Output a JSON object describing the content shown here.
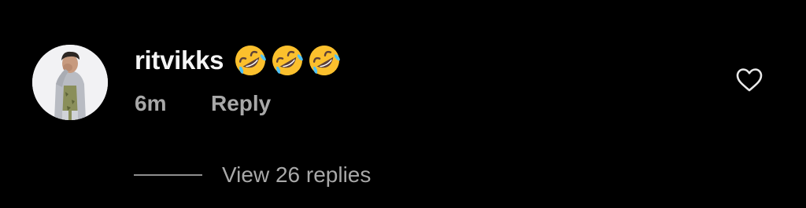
{
  "comment": {
    "username": "ritvikks",
    "emoji_icons": [
      "rolling-on-floor-laughing-emoji",
      "rolling-on-floor-laughing-emoji",
      "rolling-on-floor-laughing-emoji"
    ],
    "timestamp": "6m",
    "reply_label": "Reply",
    "view_replies_label": "View 26 replies",
    "like_icon": "heart-outline-icon"
  },
  "colors": {
    "background": "#000000",
    "username": "#f5f5f5",
    "meta_text": "#a8a8a8",
    "replies_line": "#8e8e8e",
    "emoji_face": "#fbc02d",
    "emoji_tear": "#4fc3f7"
  }
}
